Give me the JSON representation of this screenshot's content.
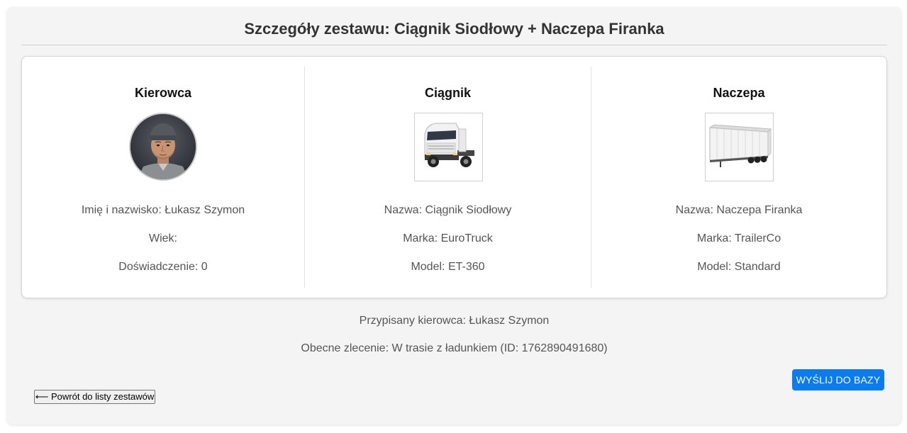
{
  "title": "Szczegóły zestawu: Ciągnik Siodłowy + Naczepa Firanka",
  "driver": {
    "heading": "Kierowca",
    "name_label": "Imię i nazwisko:",
    "name": "Łukasz Szymon",
    "age_label": "Wiek:",
    "age": "",
    "experience_label": "Doświadczenie:",
    "experience": "0"
  },
  "tractor": {
    "heading": "Ciągnik",
    "name_label": "Nazwa:",
    "name": "Ciągnik Siodłowy",
    "brand_label": "Marka:",
    "brand": "EuroTruck",
    "model_label": "Model:",
    "model": "ET-360"
  },
  "trailer": {
    "heading": "Naczepa",
    "name_label": "Nazwa:",
    "name": "Naczepa Firanka",
    "brand_label": "Marka:",
    "brand": "TrailerCo",
    "model_label": "Model:",
    "model": "Standard"
  },
  "assignment": {
    "assigned_driver": "Przypisany kierowca: Łukasz Szymon",
    "current_order": "Obecne zlecenie: W trasie z ładunkiem (ID: 1762890491680)"
  },
  "buttons": {
    "send": "WYŚLIJ DO BAZY",
    "back": "⟵ Powrót do listy zestawów"
  },
  "colors": {
    "accent": "#0a7cf0",
    "background": "#f4f4f4",
    "card": "#ffffff"
  },
  "icons": {
    "driver_photo": "driver-avatar-photo",
    "tractor_photo": "truck-tractor-photo",
    "trailer_photo": "curtain-trailer-photo"
  }
}
